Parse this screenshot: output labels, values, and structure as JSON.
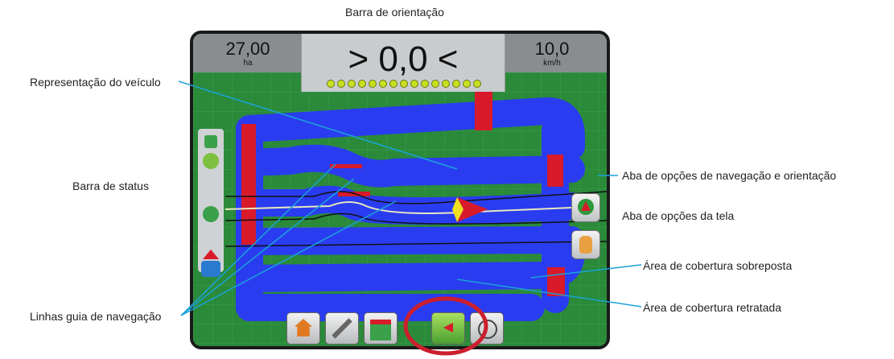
{
  "labels": {
    "guidance_bar": "Barra de orientação",
    "vehicle": "Representação do veículo",
    "status_bar": "Barra de status",
    "guide_lines": "Linhas guia de navegação",
    "nav_tab": "Aba de opções de navegação e orientação",
    "screen_tab": "Aba de opções da tela",
    "overlap_area": "Área de cobertura sobreposta",
    "coverage_area": "Área de cobertura retratada"
  },
  "display": {
    "area_value": "27,00",
    "area_unit": "ha",
    "speed_value": "10,0",
    "speed_unit": "km/h",
    "guidance_value": "> 0,0 <",
    "lightbar_count": 15
  },
  "colors": {
    "field": "#2a8a3a",
    "coverage": "#2a3cf0",
    "overlap": "#d81a2a",
    "callout_line": "#1aa3d8",
    "highlight_ring": "#cc1f2e",
    "lightbar_led": "#c8e020"
  },
  "icons": {
    "vehicle": "arrow-icon",
    "home": "home-icon",
    "tools": "tools-icon",
    "view": "field-view-icon",
    "guidance": "guidance-screen-icon",
    "camera": "camera-icon",
    "nav_options": "triangle-icon",
    "screen_options": "hand-icon"
  }
}
